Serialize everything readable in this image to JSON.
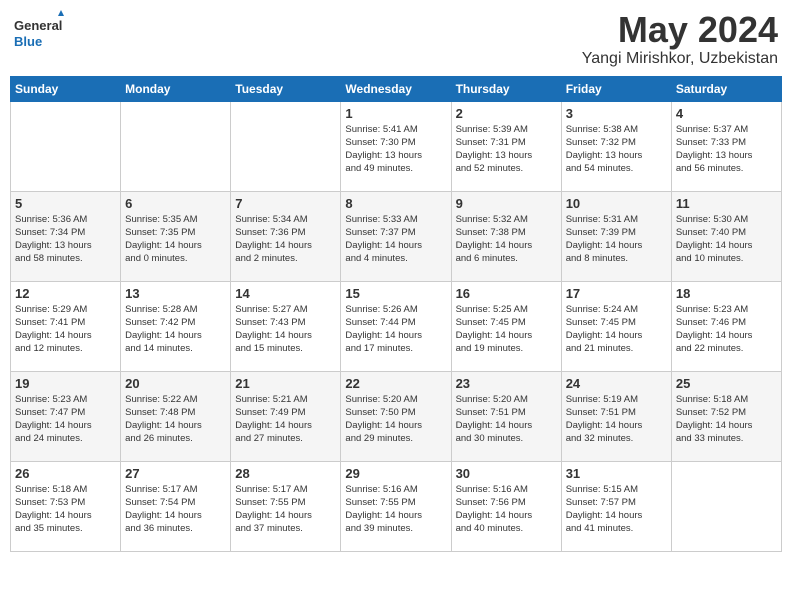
{
  "logo": {
    "line1": "General",
    "line2": "Blue"
  },
  "title": "May 2024",
  "location": "Yangi Mirishkor, Uzbekistan",
  "headers": [
    "Sunday",
    "Monday",
    "Tuesday",
    "Wednesday",
    "Thursday",
    "Friday",
    "Saturday"
  ],
  "weeks": [
    [
      {
        "day": "",
        "info": ""
      },
      {
        "day": "",
        "info": ""
      },
      {
        "day": "",
        "info": ""
      },
      {
        "day": "1",
        "info": "Sunrise: 5:41 AM\nSunset: 7:30 PM\nDaylight: 13 hours\nand 49 minutes."
      },
      {
        "day": "2",
        "info": "Sunrise: 5:39 AM\nSunset: 7:31 PM\nDaylight: 13 hours\nand 52 minutes."
      },
      {
        "day": "3",
        "info": "Sunrise: 5:38 AM\nSunset: 7:32 PM\nDaylight: 13 hours\nand 54 minutes."
      },
      {
        "day": "4",
        "info": "Sunrise: 5:37 AM\nSunset: 7:33 PM\nDaylight: 13 hours\nand 56 minutes."
      }
    ],
    [
      {
        "day": "5",
        "info": "Sunrise: 5:36 AM\nSunset: 7:34 PM\nDaylight: 13 hours\nand 58 minutes."
      },
      {
        "day": "6",
        "info": "Sunrise: 5:35 AM\nSunset: 7:35 PM\nDaylight: 14 hours\nand 0 minutes."
      },
      {
        "day": "7",
        "info": "Sunrise: 5:34 AM\nSunset: 7:36 PM\nDaylight: 14 hours\nand 2 minutes."
      },
      {
        "day": "8",
        "info": "Sunrise: 5:33 AM\nSunset: 7:37 PM\nDaylight: 14 hours\nand 4 minutes."
      },
      {
        "day": "9",
        "info": "Sunrise: 5:32 AM\nSunset: 7:38 PM\nDaylight: 14 hours\nand 6 minutes."
      },
      {
        "day": "10",
        "info": "Sunrise: 5:31 AM\nSunset: 7:39 PM\nDaylight: 14 hours\nand 8 minutes."
      },
      {
        "day": "11",
        "info": "Sunrise: 5:30 AM\nSunset: 7:40 PM\nDaylight: 14 hours\nand 10 minutes."
      }
    ],
    [
      {
        "day": "12",
        "info": "Sunrise: 5:29 AM\nSunset: 7:41 PM\nDaylight: 14 hours\nand 12 minutes."
      },
      {
        "day": "13",
        "info": "Sunrise: 5:28 AM\nSunset: 7:42 PM\nDaylight: 14 hours\nand 14 minutes."
      },
      {
        "day": "14",
        "info": "Sunrise: 5:27 AM\nSunset: 7:43 PM\nDaylight: 14 hours\nand 15 minutes."
      },
      {
        "day": "15",
        "info": "Sunrise: 5:26 AM\nSunset: 7:44 PM\nDaylight: 14 hours\nand 17 minutes."
      },
      {
        "day": "16",
        "info": "Sunrise: 5:25 AM\nSunset: 7:45 PM\nDaylight: 14 hours\nand 19 minutes."
      },
      {
        "day": "17",
        "info": "Sunrise: 5:24 AM\nSunset: 7:45 PM\nDaylight: 14 hours\nand 21 minutes."
      },
      {
        "day": "18",
        "info": "Sunrise: 5:23 AM\nSunset: 7:46 PM\nDaylight: 14 hours\nand 22 minutes."
      }
    ],
    [
      {
        "day": "19",
        "info": "Sunrise: 5:23 AM\nSunset: 7:47 PM\nDaylight: 14 hours\nand 24 minutes."
      },
      {
        "day": "20",
        "info": "Sunrise: 5:22 AM\nSunset: 7:48 PM\nDaylight: 14 hours\nand 26 minutes."
      },
      {
        "day": "21",
        "info": "Sunrise: 5:21 AM\nSunset: 7:49 PM\nDaylight: 14 hours\nand 27 minutes."
      },
      {
        "day": "22",
        "info": "Sunrise: 5:20 AM\nSunset: 7:50 PM\nDaylight: 14 hours\nand 29 minutes."
      },
      {
        "day": "23",
        "info": "Sunrise: 5:20 AM\nSunset: 7:51 PM\nDaylight: 14 hours\nand 30 minutes."
      },
      {
        "day": "24",
        "info": "Sunrise: 5:19 AM\nSunset: 7:51 PM\nDaylight: 14 hours\nand 32 minutes."
      },
      {
        "day": "25",
        "info": "Sunrise: 5:18 AM\nSunset: 7:52 PM\nDaylight: 14 hours\nand 33 minutes."
      }
    ],
    [
      {
        "day": "26",
        "info": "Sunrise: 5:18 AM\nSunset: 7:53 PM\nDaylight: 14 hours\nand 35 minutes."
      },
      {
        "day": "27",
        "info": "Sunrise: 5:17 AM\nSunset: 7:54 PM\nDaylight: 14 hours\nand 36 minutes."
      },
      {
        "day": "28",
        "info": "Sunrise: 5:17 AM\nSunset: 7:55 PM\nDaylight: 14 hours\nand 37 minutes."
      },
      {
        "day": "29",
        "info": "Sunrise: 5:16 AM\nSunset: 7:55 PM\nDaylight: 14 hours\nand 39 minutes."
      },
      {
        "day": "30",
        "info": "Sunrise: 5:16 AM\nSunset: 7:56 PM\nDaylight: 14 hours\nand 40 minutes."
      },
      {
        "day": "31",
        "info": "Sunrise: 5:15 AM\nSunset: 7:57 PM\nDaylight: 14 hours\nand 41 minutes."
      },
      {
        "day": "",
        "info": ""
      }
    ]
  ]
}
